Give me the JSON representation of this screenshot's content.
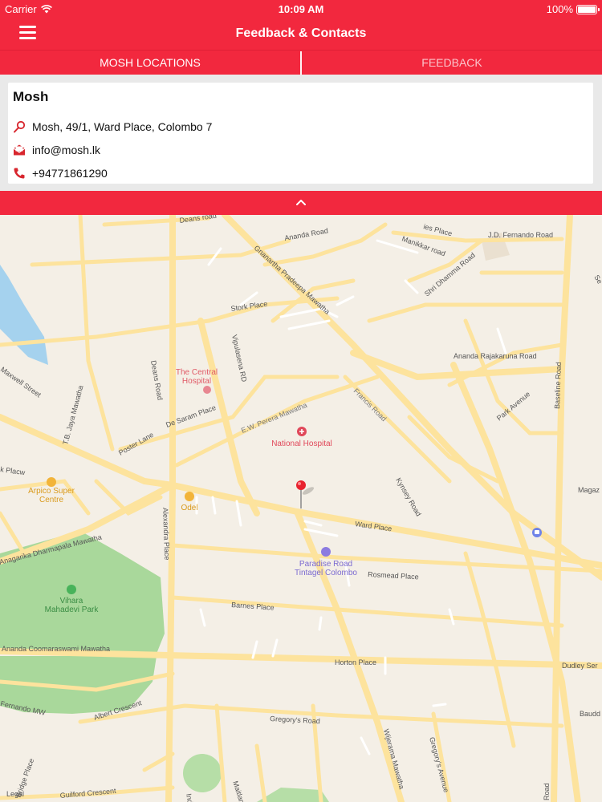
{
  "status_bar": {
    "carrier": "Carrier",
    "time": "10:09 AM",
    "battery": "100%",
    "battery_level": 1.0
  },
  "navbar": {
    "title": "Feedback & Contacts"
  },
  "tabs": [
    {
      "label": "MOSH LOCATIONS",
      "active": true
    },
    {
      "label": "FEEDBACK",
      "active": false
    }
  ],
  "card": {
    "name": "Mosh",
    "address": "Mosh, 49/1, Ward Place, Colombo 7",
    "email": "info@mosh.lk",
    "phone": "+94771861290"
  },
  "colors": {
    "accent": "#f2283e",
    "road": "#fde39d",
    "park": "#a9d89b",
    "water": "#a5d2ee"
  },
  "map": {
    "roads": {
      "deans_road_top": "Deans road",
      "ananda_road": "Ananda Road",
      "gnanartha": "Gnanartha Pradeepa Mawatha",
      "manikkar": "Manikkar road",
      "shri_dhamma": "Shri Dhamma Road",
      "jd_fernando": "J.D. Fernando Road",
      "stork_place": "Stork Place",
      "vipulasena": "Vipulasena RD",
      "ananda_rajakaruna": "Ananda Rajakaruna Road",
      "baseline": "Baseline Road",
      "maxwell": "Maxwell Street",
      "jaya_mawatha": "T.B. Jaya Mawatha",
      "deans_road": "Deans Road",
      "ew_perera": "E.W. Perera Mawatha",
      "francis": "Francis Road",
      "park_avenue": "Park Avenue",
      "de_saram": "De Saram Place",
      "poster_lane": "Poster Lane",
      "kinsey": "Kynsey Road",
      "ward_place": "Ward Place",
      "alexandra": "Alexandra Place",
      "dharmapala": "Anagarika Dharmapala Mawatha",
      "rosmead": "Rosmead Place",
      "barnes": "Barnes Place",
      "coomaraswami": "Ananda Coomaraswami Mawatha",
      "horton": "Horton Place",
      "dudley": "Dudley Ser",
      "fernando_mw": "Fernando MW",
      "albert": "Albert Crescent",
      "gregorys_road": "Gregory's Road",
      "wijerama": "Wijerama Mawatha",
      "gregorys_avenue": "Gregory's Avenue",
      "bridge_place": "Bridge Place",
      "guilford": "Guilford Crescent",
      "maitland": "Maitland",
      "magaz": "Magaz",
      "baudd": "Baudd",
      "place_partial": "k Placw",
      "es_place": "ies Place",
      "se_partial": "Se",
      "road_partial": "Road",
      "ind": "Ind"
    },
    "pois": {
      "central_hospital": [
        "The Central",
        "Hospital"
      ],
      "national_hospital": "National Hospital",
      "arpico": [
        "Arpico Super",
        "Centre"
      ],
      "odel": "Odel",
      "paradise": [
        "Paradise Road",
        "Tintagel Colombo"
      ],
      "vihara": [
        "Vihara",
        "Mahadevi Park"
      ],
      "legal": "Legal"
    }
  }
}
